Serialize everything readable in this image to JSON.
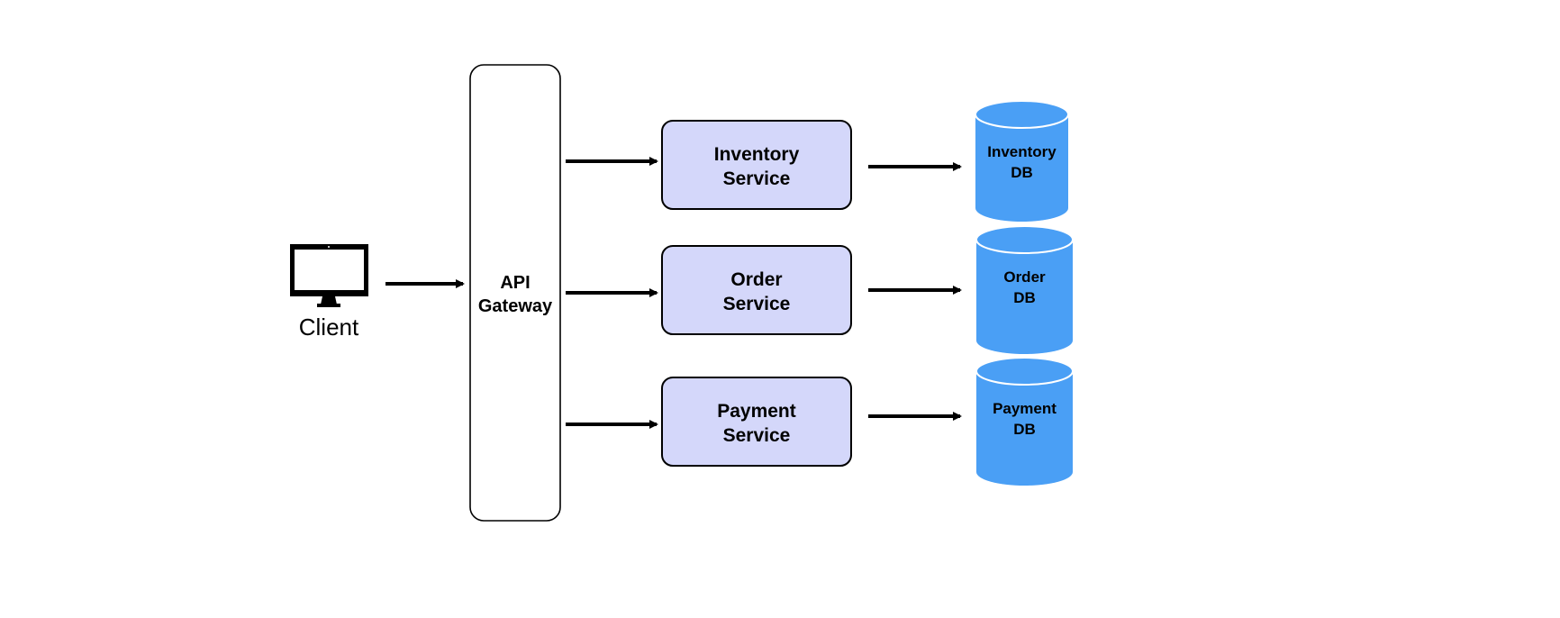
{
  "client": {
    "label": "Client",
    "icon": "monitor-icon"
  },
  "gateway": {
    "line1": "API",
    "line2": "Gateway"
  },
  "services": [
    {
      "line1": "Inventory",
      "line2": "Service"
    },
    {
      "line1": "Order",
      "line2": "Service"
    },
    {
      "line1": "Payment",
      "line2": "Service"
    }
  ],
  "databases": [
    {
      "line1": "Inventory",
      "line2": "DB"
    },
    {
      "line1": "Order",
      "line2": "DB"
    },
    {
      "line1": "Payment",
      "line2": "DB"
    }
  ],
  "colors": {
    "service_fill": "#d4d7fa",
    "db_fill": "#4a9ff5",
    "stroke": "#000000"
  }
}
